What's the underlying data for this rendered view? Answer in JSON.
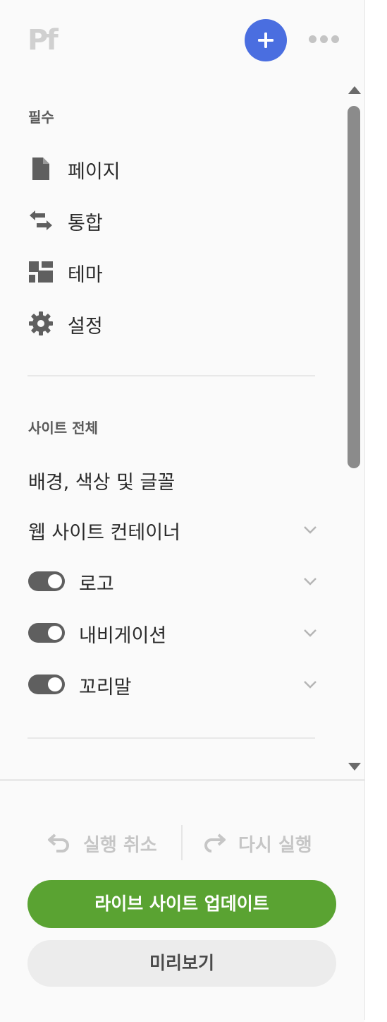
{
  "header": {
    "logo_text": "Pf",
    "add_icon": "plus-icon",
    "more_icon": "more-icon"
  },
  "essentials": {
    "title": "필수",
    "items": [
      {
        "label": "페이지",
        "icon": "page-icon"
      },
      {
        "label": "통합",
        "icon": "integration-arrows-icon"
      },
      {
        "label": "테마",
        "icon": "theme-layout-icon"
      },
      {
        "label": "설정",
        "icon": "gear-icon"
      }
    ]
  },
  "site_wide": {
    "title": "사이트 전체",
    "items": [
      {
        "label": "배경, 색상 및 글꼴",
        "toggle": null,
        "chevron": false
      },
      {
        "label": "웹 사이트 컨테이너",
        "toggle": null,
        "chevron": true
      },
      {
        "label": "로고",
        "toggle": true,
        "chevron": true
      },
      {
        "label": "내비게이션",
        "toggle": true,
        "chevron": true
      },
      {
        "label": "꼬리말",
        "toggle": true,
        "chevron": true
      }
    ]
  },
  "footer": {
    "undo_label": "실행 취소",
    "redo_label": "다시 실행",
    "live_button": "라이브 사이트 업데이트",
    "preview_button": "미리보기"
  },
  "colors": {
    "accent": "#4a6ee0",
    "live_green": "#5aa332",
    "toggle_on": "#5f5f5f"
  }
}
